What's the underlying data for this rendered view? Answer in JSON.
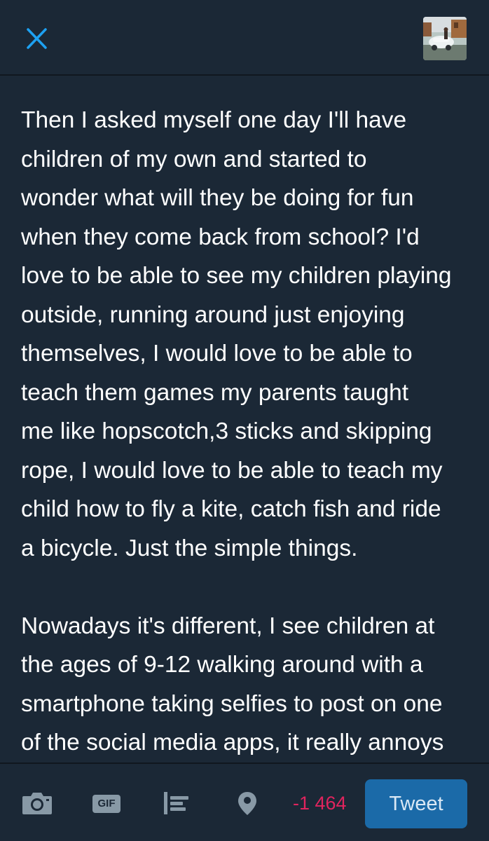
{
  "header": {
    "close_icon": "close-icon",
    "avatar_icon": "profile-photo"
  },
  "compose": {
    "text": "Then I asked myself one day I'll have\nchildren of my own and started to\nwonder what will they be doing for fun\nwhen they come back from school? I'd\nlove to be able to see my children playing\noutside, running around just enjoying\nthemselves, I would love to be able to\nteach them games my parents taught\nme like hopscotch,3 sticks and skipping\nrope, I would love to be able to teach my\nchild how to fly a kite, catch fish and ride\na bicycle. Just the simple things.\n\nNowadays it's different, I see children at\nthe ages of 9-12 walking around with a\nsmartphone taking selfies to post on one\nof the social media apps, it really annoys"
  },
  "toolbar": {
    "tools": [
      "camera-icon",
      "gif-icon",
      "poll-icon",
      "location-icon"
    ],
    "gif_label": "GIF",
    "char_counter": "-1 464",
    "tweet_label": "Tweet"
  },
  "colors": {
    "background": "#1b2836",
    "accent": "#1da1f2",
    "icon": "#8899a6",
    "counter_over_limit": "#e0245e",
    "tweet_button": "#1b6aa8"
  }
}
